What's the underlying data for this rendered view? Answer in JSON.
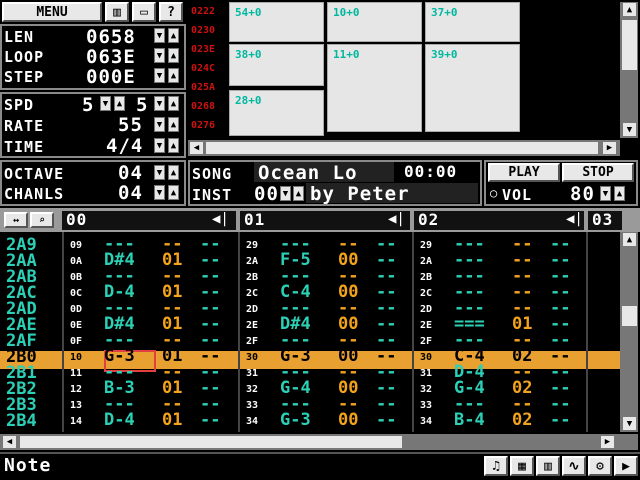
{
  "top": {
    "menu_label": "MENU",
    "icons": [
      "bars-icon",
      "monitor-icon",
      "help-icon"
    ]
  },
  "params": {
    "len_label": "LEN",
    "len_value": "0658",
    "loop_label": "LOOP",
    "loop_value": "063E",
    "step_label": "STEP",
    "step_value": "000E",
    "spd_label": "SPD",
    "spd_a": "5",
    "spd_b": "5",
    "rate_label": "RATE",
    "rate_value": "55",
    "time_label": "TIME",
    "time_value": "4/4"
  },
  "sequencer": {
    "rows": [
      "0222",
      "0230",
      "023E",
      "024C",
      "025A",
      "0268",
      "0276"
    ],
    "patterns": [
      {
        "label": "54+0"
      },
      {
        "label": "10+0"
      },
      {
        "label": "37+0"
      },
      {
        "label": "38+0"
      },
      {
        "label": "11+0"
      },
      {
        "label": "39+0"
      },
      {
        "label": "28+0"
      }
    ]
  },
  "octave": {
    "label": "OCTAVE",
    "value": "04"
  },
  "chanls": {
    "label": "CHANLS",
    "value": "04"
  },
  "song": {
    "label": "SONG",
    "name": "Ocean Lo",
    "time": "00:00"
  },
  "inst": {
    "label": "INST",
    "num": "00",
    "name": "by Peter"
  },
  "transport": {
    "play": "PLAY",
    "stop": "STOP",
    "vol_label": "VOL",
    "vol_value": "80"
  },
  "channels": [
    "00",
    "01",
    "02",
    "03"
  ],
  "tracker": {
    "row_labels": [
      "2A9",
      "2AA",
      "2AB",
      "2AC",
      "2AD",
      "2AE",
      "2AF",
      "2B0",
      "2B1",
      "2B2",
      "2B3",
      "2B4"
    ],
    "ch0": [
      {
        "rn": "09",
        "note": "---",
        "ins": "--",
        "fx": "--"
      },
      {
        "rn": "0A",
        "note": "D#4",
        "ins": "01",
        "fx": "--"
      },
      {
        "rn": "0B",
        "note": "---",
        "ins": "--",
        "fx": "--"
      },
      {
        "rn": "0C",
        "note": "D-4",
        "ins": "01",
        "fx": "--"
      },
      {
        "rn": "0D",
        "note": "---",
        "ins": "--",
        "fx": "--"
      },
      {
        "rn": "0E",
        "note": "D#4",
        "ins": "01",
        "fx": "--"
      },
      {
        "rn": "0F",
        "note": "---",
        "ins": "--",
        "fx": "--"
      },
      {
        "rn": "10",
        "note": "G-3",
        "ins": "01",
        "fx": "--"
      },
      {
        "rn": "11",
        "note": "---",
        "ins": "--",
        "fx": "--"
      },
      {
        "rn": "12",
        "note": "B-3",
        "ins": "01",
        "fx": "--"
      },
      {
        "rn": "13",
        "note": "---",
        "ins": "--",
        "fx": "--"
      },
      {
        "rn": "14",
        "note": "D-4",
        "ins": "01",
        "fx": "--"
      }
    ],
    "ch1": [
      {
        "rn": "29",
        "note": "---",
        "ins": "--",
        "fx": "--"
      },
      {
        "rn": "2A",
        "note": "F-5",
        "ins": "00",
        "fx": "--"
      },
      {
        "rn": "2B",
        "note": "---",
        "ins": "--",
        "fx": "--"
      },
      {
        "rn": "2C",
        "note": "C-4",
        "ins": "00",
        "fx": "--"
      },
      {
        "rn": "2D",
        "note": "---",
        "ins": "--",
        "fx": "--"
      },
      {
        "rn": "2E",
        "note": "D#4",
        "ins": "00",
        "fx": "--"
      },
      {
        "rn": "2F",
        "note": "---",
        "ins": "--",
        "fx": "--"
      },
      {
        "rn": "30",
        "note": "G-3",
        "ins": "00",
        "fx": "--"
      },
      {
        "rn": "31",
        "note": "---",
        "ins": "--",
        "fx": "--"
      },
      {
        "rn": "32",
        "note": "G-4",
        "ins": "00",
        "fx": "--"
      },
      {
        "rn": "33",
        "note": "---",
        "ins": "--",
        "fx": "--"
      },
      {
        "rn": "34",
        "note": "G-3",
        "ins": "00",
        "fx": "--"
      }
    ],
    "ch2": [
      {
        "rn": "29",
        "note": "---",
        "ins": "--",
        "fx": "--"
      },
      {
        "rn": "2A",
        "note": "---",
        "ins": "--",
        "fx": "--"
      },
      {
        "rn": "2B",
        "note": "---",
        "ins": "--",
        "fx": "--"
      },
      {
        "rn": "2C",
        "note": "---",
        "ins": "--",
        "fx": "--"
      },
      {
        "rn": "2D",
        "note": "---",
        "ins": "--",
        "fx": "--"
      },
      {
        "rn": "2E",
        "note": "===",
        "ins": "01",
        "fx": "--"
      },
      {
        "rn": "2F",
        "note": "---",
        "ins": "--",
        "fx": "--"
      },
      {
        "rn": "30",
        "note": "C-4",
        "ins": "02",
        "fx": "--"
      },
      {
        "rn": "31",
        "note": "D-4",
        "ins": "--",
        "fx": "--"
      },
      {
        "rn": "32",
        "note": "G-4",
        "ins": "02",
        "fx": "--"
      },
      {
        "rn": "33",
        "note": "---",
        "ins": "--",
        "fx": "--"
      },
      {
        "rn": "34",
        "note": "B-4",
        "ins": "02",
        "fx": "--"
      }
    ]
  },
  "status": {
    "text": "Note"
  },
  "colors": {
    "accent": "#f2a31c",
    "note": "#2bd0b6",
    "highlight": "#e8a030",
    "hex_red": "#cc1111"
  }
}
